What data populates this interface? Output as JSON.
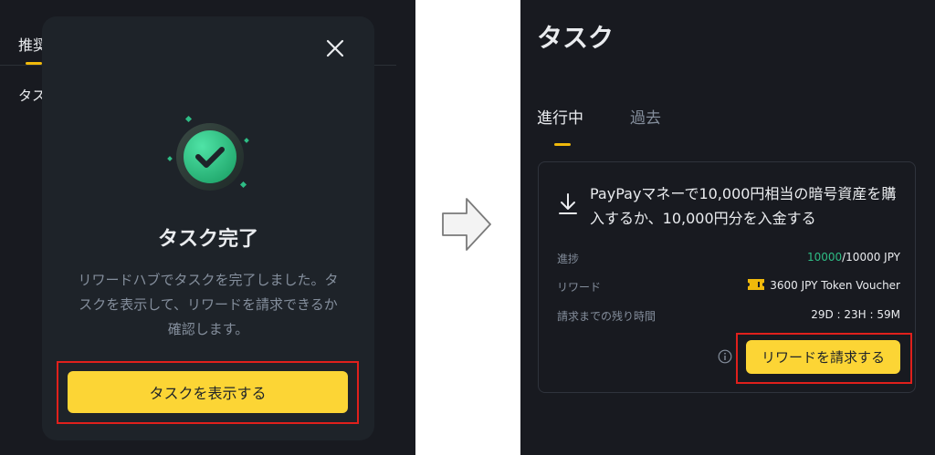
{
  "left": {
    "background_tab": "推奨",
    "background_label": "タス",
    "modal": {
      "close_icon": "close-icon",
      "status_icon": "check-circle-icon",
      "title": "タスク完了",
      "description": "リワードハブでタスクを完了しました。タスクを表示して、リワードを請求できるか確認します。",
      "button_label": "タスクを表示する"
    }
  },
  "arrow_icon": "right-arrow-icon",
  "right": {
    "page_title": "タスク",
    "tabs": [
      {
        "label": "進行中",
        "active": true
      },
      {
        "label": "過去",
        "active": false
      }
    ],
    "task": {
      "icon": "download-icon",
      "title": "PayPayマネーで10,000円相当の暗号資産を購入するか、10,000円分を入金する",
      "progress_label": "進捗",
      "progress_current": "10000",
      "progress_total": "/10000 JPY",
      "reward_label": "リワード",
      "reward_value": "3600 JPY Token Voucher",
      "time_label": "請求までの残り時間",
      "time_value": "29D : 23H : 59M",
      "info_icon": "info-icon",
      "claim_button_label": "リワードを請求する"
    }
  },
  "colors": {
    "background": "#181a20",
    "card": "#1e2329",
    "accent_yellow": "#fcd535",
    "success_green": "#2ebd85",
    "highlight_red": "#e0201c"
  }
}
